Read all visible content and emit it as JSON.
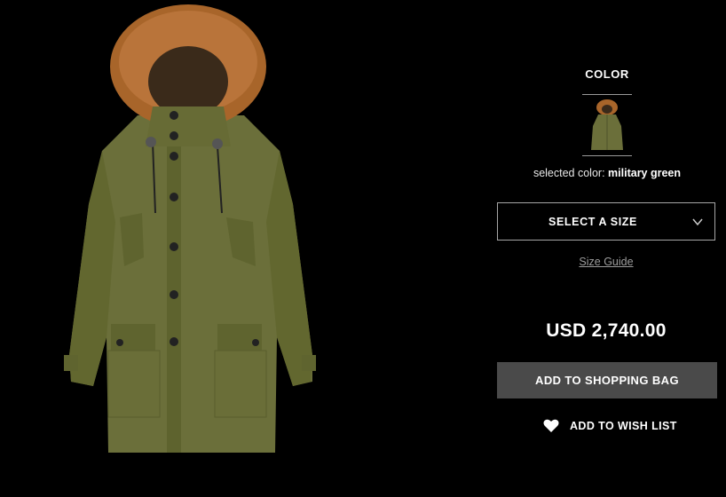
{
  "product": {
    "image_alt": "military green parka with fur hood",
    "coat_color": "#6b6f3a",
    "fur_color": "#a8652a"
  },
  "color_section": {
    "heading": "COLOR",
    "selected_prefix": "selected color:",
    "selected_value": "military green"
  },
  "size": {
    "select_label": "SELECT A SIZE",
    "guide_link": "Size Guide"
  },
  "pricing": {
    "price": "USD 2,740.00"
  },
  "actions": {
    "add_to_bag": "ADD TO SHOPPING BAG",
    "add_to_wishlist": "ADD TO WISH LIST"
  }
}
